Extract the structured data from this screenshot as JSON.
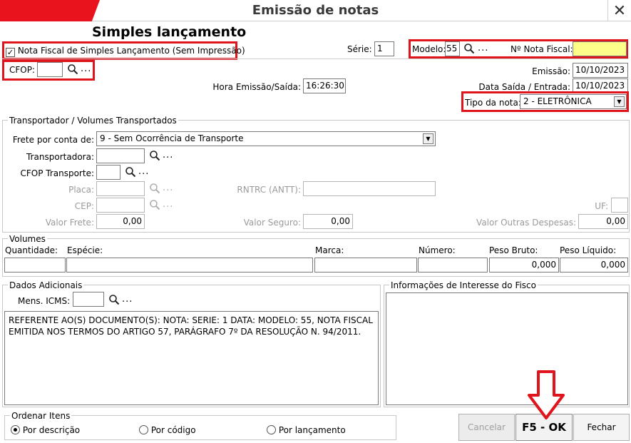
{
  "window": {
    "title": "Emissão de notas",
    "close_icon": "close-icon"
  },
  "header": {
    "heading": "Simples lançamento"
  },
  "simples": {
    "checkbox_label": "Nota Fiscal de Simples Lançamento (Sem Impressão)",
    "checked": true
  },
  "serie": {
    "label": "Série:",
    "value": "1"
  },
  "modelo": {
    "label": "Modelo:",
    "value": "55",
    "dots": "..."
  },
  "nota_fiscal": {
    "label": "Nº Nota Fiscal:",
    "value": ""
  },
  "cfop": {
    "label": "CFOP:",
    "value": "",
    "dots": "..."
  },
  "emissao": {
    "label": "Emissão:",
    "value": "10/10/2023"
  },
  "hora": {
    "label": "Hora Emissão/Saída:",
    "value": "16:26:30"
  },
  "data_saida": {
    "label": "Data Saída / Entrada:",
    "value": "10/10/2023"
  },
  "tipo_nota": {
    "label": "Tipo da nota:",
    "value": "2 - ELETRÔNICA"
  },
  "transporte": {
    "title": "Transportador /  Volumes Transportados",
    "frete_label": "Frete por conta de:",
    "frete_value": "9 - Sem Ocorrência de Transporte",
    "transportadora_label": "Transportadora:",
    "cfop_transporte_label": "CFOP Transporte:",
    "placa_label": "Placa:",
    "rntrc_label": "RNTRC (ANTT):",
    "cep_label": "CEP:",
    "uf_label": "UF:",
    "valor_frete_label": "Valor Frete:",
    "valor_frete": "0,00",
    "valor_seguro_label": "Valor Seguro:",
    "valor_seguro": "0,00",
    "valor_outras_label": "Valor Outras Despesas:",
    "valor_outras": "0,00",
    "dots": "..."
  },
  "volumes": {
    "title": "Volumes",
    "cols": [
      "Quantidade:",
      "Espécie:",
      "Marca:",
      "Número:",
      "Peso Bruto:",
      "Peso Líquido:"
    ],
    "peso_bruto": "0,000",
    "peso_liquido": "0,000"
  },
  "dados": {
    "title": "Dados Adicionais",
    "mens_label": "Mens. ICMS:",
    "dots": "...",
    "text": "REFERENTE AO(S) DOCUMENTO(S): NOTA:          SERIE: 1 DATA:                  MODELO: 55, NOTA FISCAL EMITIDA NOS TERMOS DO ARTIGO 57, PARÁGRAFO 7º DA RESOLUÇÃO N. 94/2011."
  },
  "fisco": {
    "title": "Informações de Interesse do Fisco"
  },
  "ordenar": {
    "title": "Ordenar Itens",
    "options": [
      "Por descrição",
      "Por código",
      "Por lançamento"
    ],
    "selected": 0
  },
  "buttons": {
    "cancelar": "Cancelar",
    "ok": "F5 - OK",
    "fechar": "Fechar"
  },
  "colors": {
    "accent_red": "#e0141c",
    "highlight_yellow": "#fdfd8a"
  }
}
